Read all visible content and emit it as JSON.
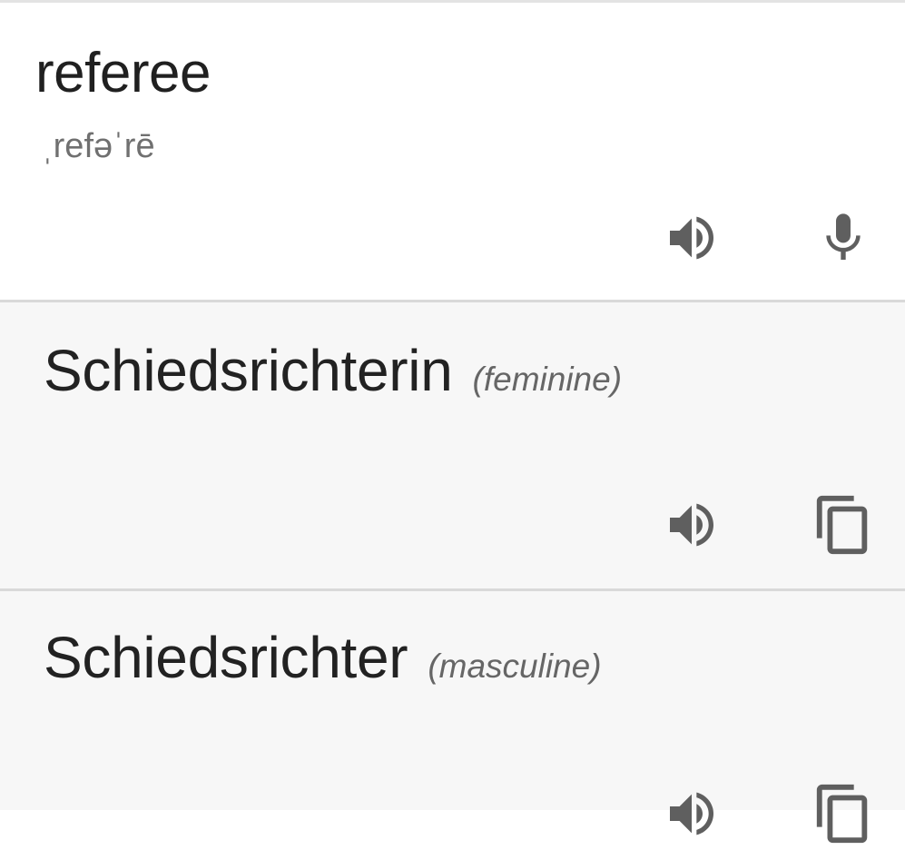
{
  "source": {
    "word": "referee",
    "phonetic": "ˌrefəˈrē",
    "icons": [
      "speaker-icon",
      "microphone-icon"
    ]
  },
  "translations": [
    {
      "word": "Schiedsrichterin",
      "gender": "(feminine)",
      "icons": [
        "speaker-icon",
        "copy-icon"
      ]
    },
    {
      "word": "Schiedsrichter",
      "gender": "(masculine)",
      "icons": [
        "speaker-icon",
        "copy-icon"
      ]
    }
  ],
  "colors": {
    "background": "#ffffff",
    "card_background": "#f7f7f7",
    "divider": "#d9d9d9",
    "text_primary": "#202020",
    "text_secondary": "#6f6f6f",
    "icon": "#5f5f5f"
  }
}
